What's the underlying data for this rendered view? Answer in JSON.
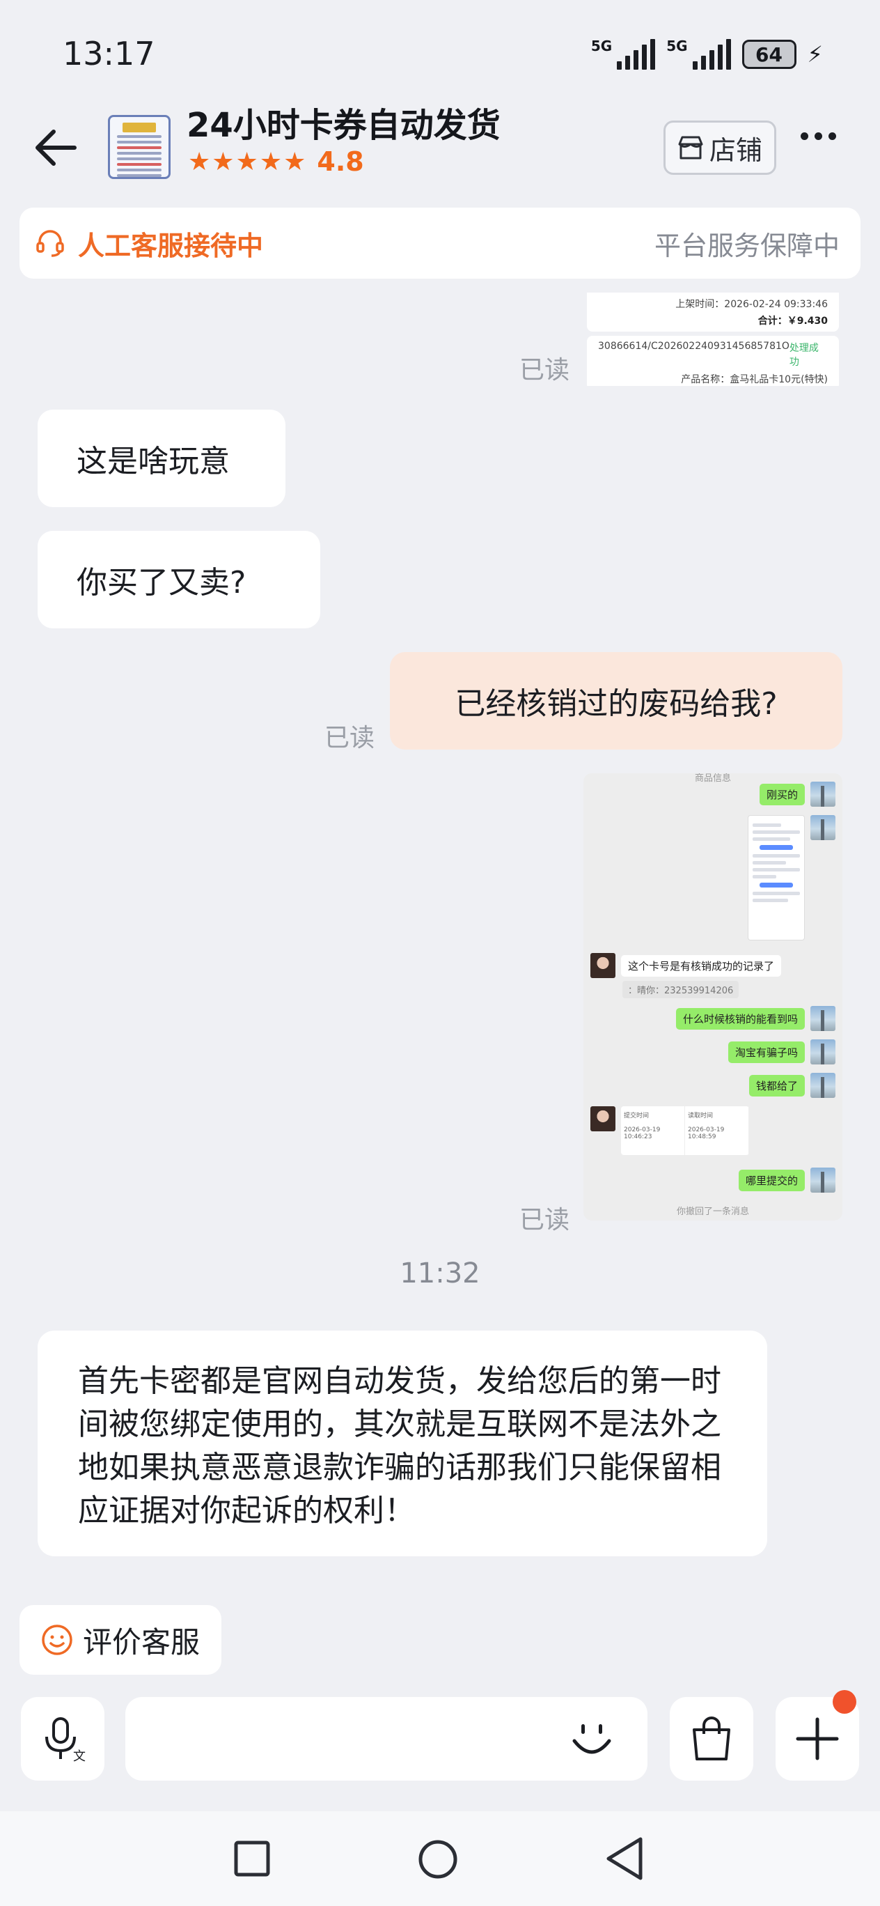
{
  "status_bar": {
    "time": "13:17",
    "signal1_label": "5G",
    "signal2_label": "5G",
    "battery": "64"
  },
  "header": {
    "shop_name": "24小时卡券自动发货",
    "stars": "★★★★★",
    "rating": "4.8",
    "store_button": "店铺"
  },
  "service_banner": {
    "left_text": "人工客服接待中",
    "right_text": "平台服务保障中"
  },
  "receipt_image": {
    "shelf_time": "上架时间：2026-02-24 09:33:46",
    "total": "合计：￥9.430",
    "order_no": "30866614/C20260224093145685781O",
    "status": "处理成功",
    "product": "产品名称：盒马礼品卡10元(特快)"
  },
  "messages": {
    "read_label": "已读",
    "msg1": "这是啥玩意",
    "msg2": "你买了又卖?",
    "msg3": "已经核销过的废码给我?",
    "timestamp": "11:32",
    "long_msg": "首先卡密都是官网自动发货，发给您后的第一时间被您绑定使用的，其次就是互联网不是法外之地如果执意恶意退款诈骗的话那我们只能保留相应证据对你起诉的权利！"
  },
  "screenshot_image": {
    "top_text": "商品信息",
    "c1": "刚买的",
    "c2": "这个卡号是有核销成功的记录了",
    "c2_quote": "：晴你：232539914206",
    "c3": "什么时候核销的能看到吗",
    "c4": "淘宝有骗子吗",
    "c5": "钱都给了",
    "table_col1": "提交时间",
    "table_col2": "读取时间",
    "table_v1": "2026-03-19 10:46:23",
    "table_v2": "2026-03-19 10:48:59",
    "c6": "哪里提交的",
    "recall": "你撤回了一条消息"
  },
  "rate_service": "评价客服",
  "input": {
    "placeholder": ""
  },
  "colors": {
    "accent": "#f26a1b",
    "outgoing_bubble": "#fbe7dc",
    "background": "#eff0f4",
    "badge": "#f0522c"
  }
}
